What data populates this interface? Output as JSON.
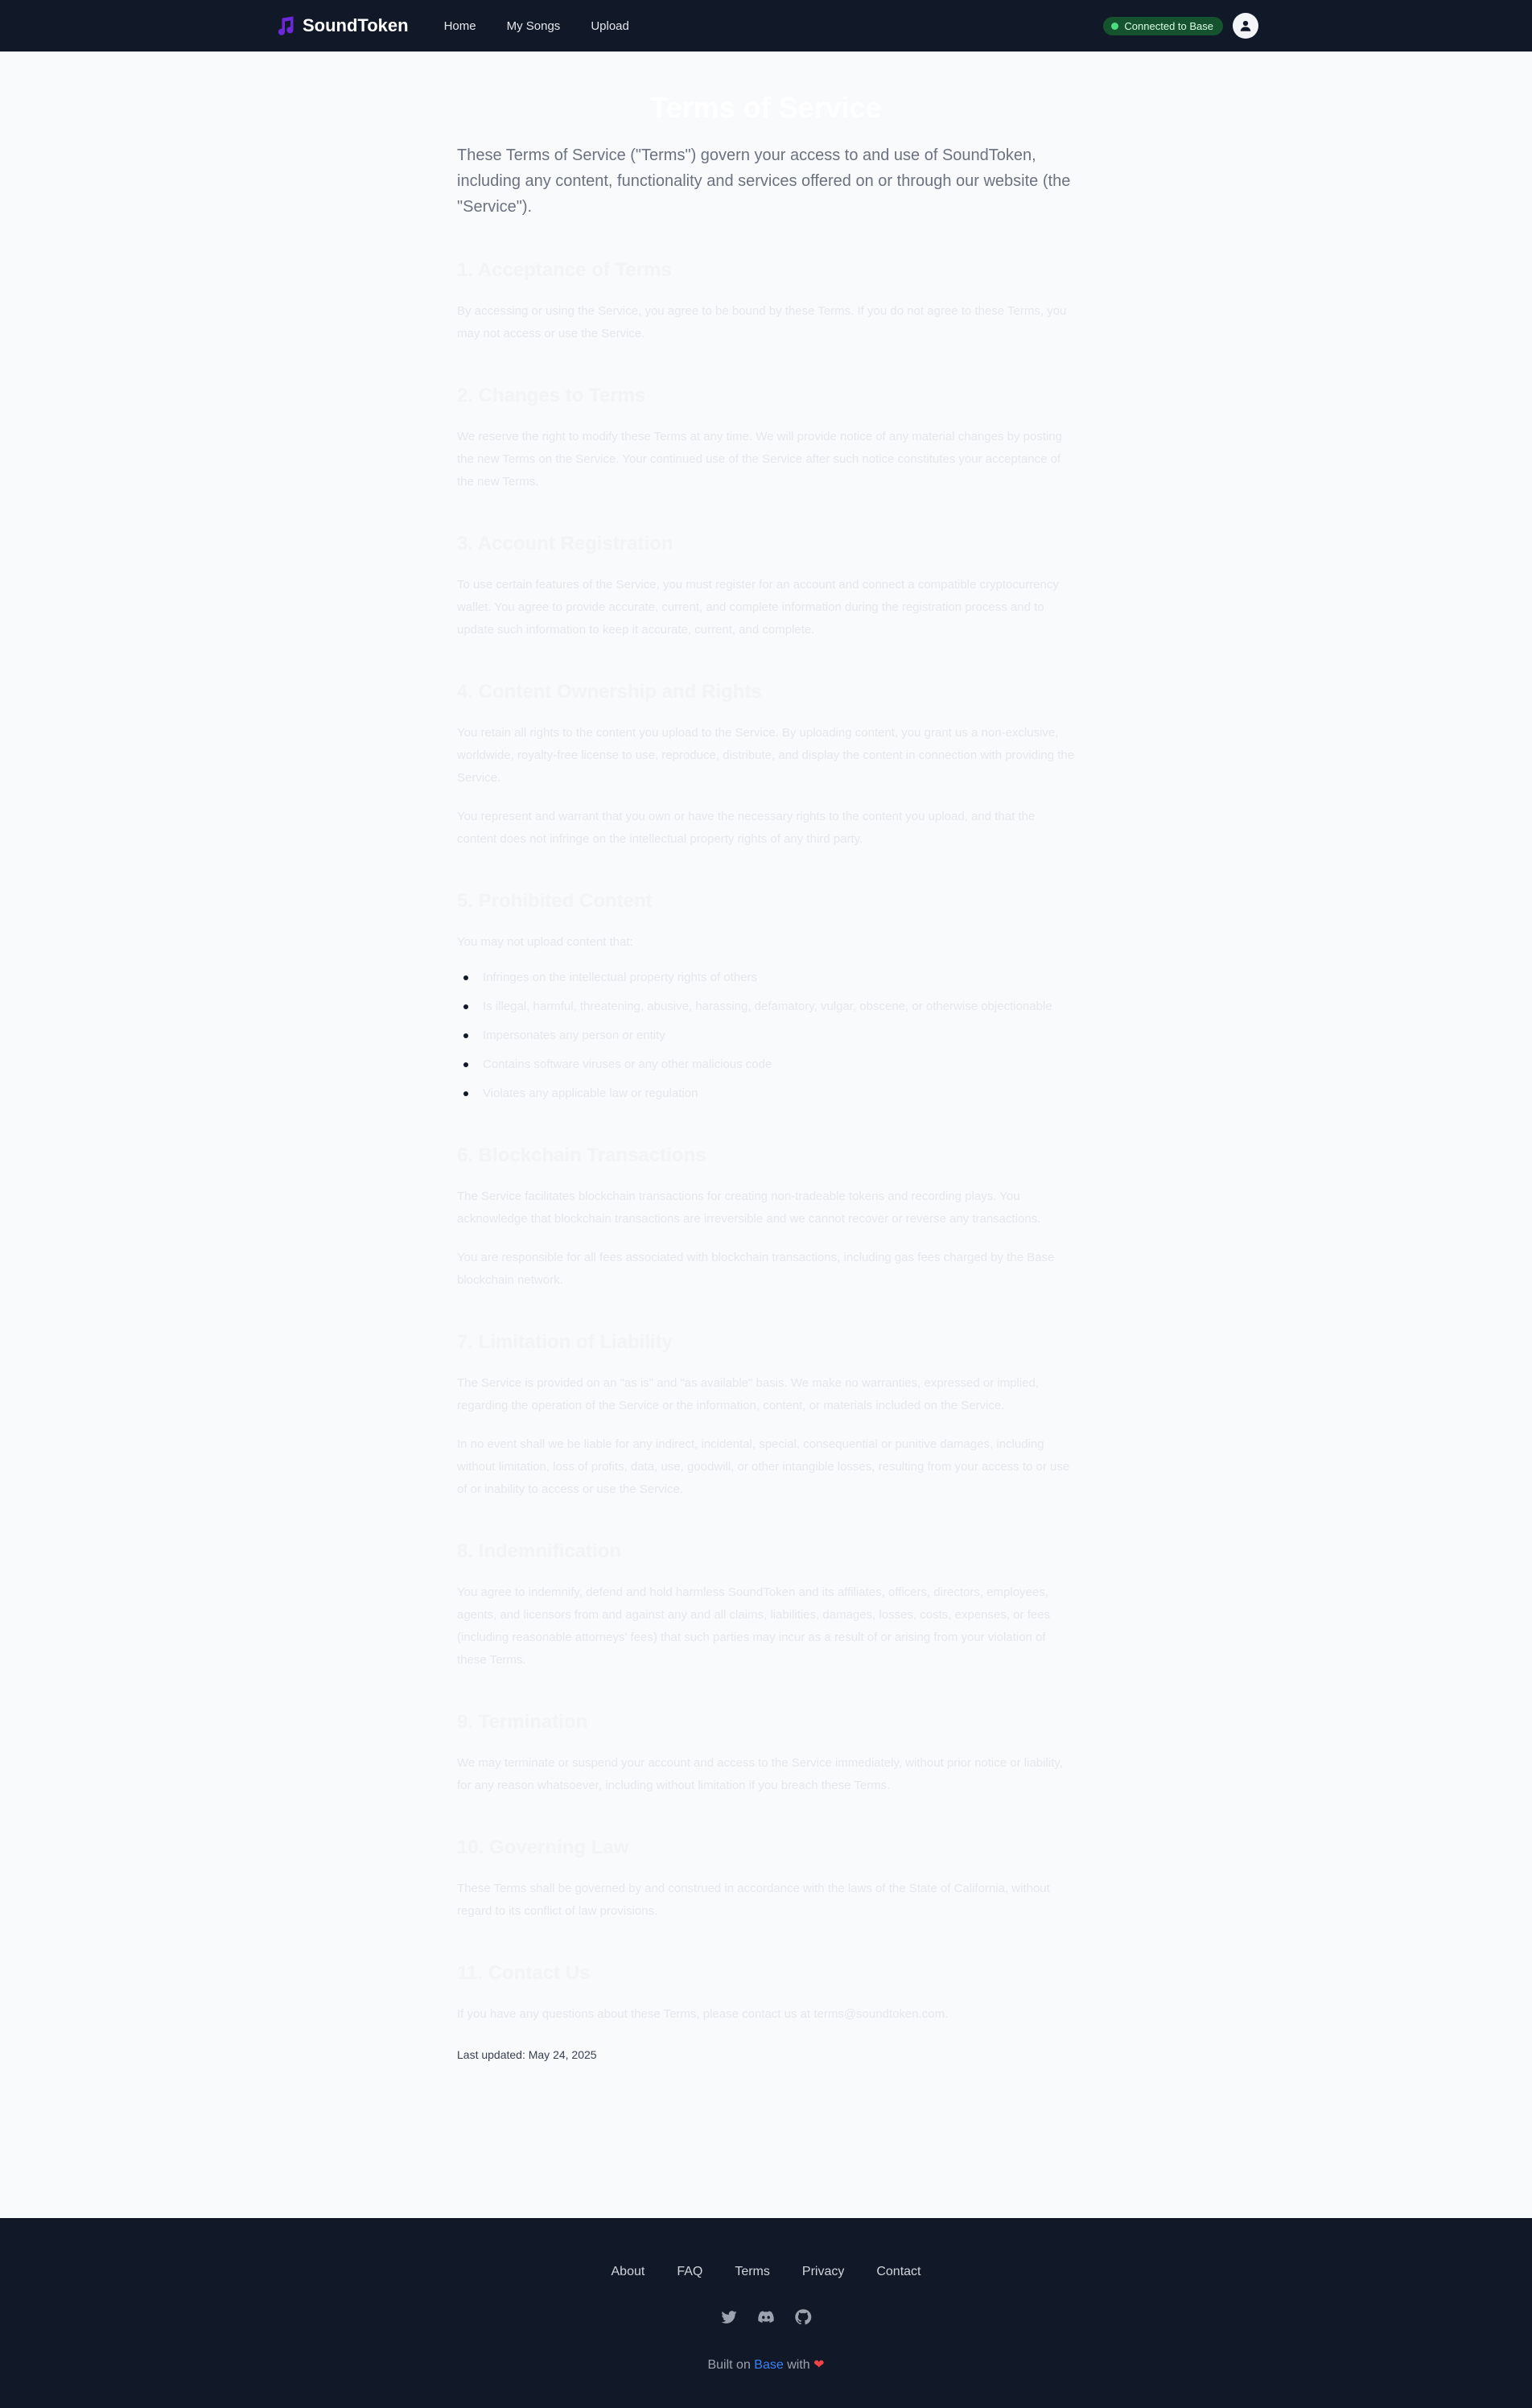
{
  "nav": {
    "brand": "SoundToken",
    "links": [
      "Home",
      "My Songs",
      "Upload"
    ],
    "status": "Connected to Base"
  },
  "page": {
    "title": "Terms of Service",
    "intro": "These Terms of Service (\"Terms\") govern your access to and use of SoundToken, including any content, functionality and services offered on or through our website (the \"Service\").",
    "sections": [
      {
        "heading": "1. Acceptance of Terms",
        "paragraphs": [
          "By accessing or using the Service, you agree to be bound by these Terms. If you do not agree to these Terms, you may not access or use the Service."
        ]
      },
      {
        "heading": "2. Changes to Terms",
        "paragraphs": [
          "We reserve the right to modify these Terms at any time. We will provide notice of any material changes by posting the new Terms on the Service. Your continued use of the Service after such notice constitutes your acceptance of the new Terms."
        ]
      },
      {
        "heading": "3. Account Registration",
        "paragraphs": [
          "To use certain features of the Service, you must register for an account and connect a compatible cryptocurrency wallet. You agree to provide accurate, current, and complete information during the registration process and to update such information to keep it accurate, current, and complete."
        ]
      },
      {
        "heading": "4. Content Ownership and Rights",
        "paragraphs": [
          "You retain all rights to the content you upload to the Service. By uploading content, you grant us a non-exclusive, worldwide, royalty-free license to use, reproduce, distribute, and display the content in connection with providing the Service.",
          "You represent and warrant that you own or have the necessary rights to the content you upload, and that the content does not infringe on the intellectual property rights of any third party."
        ]
      },
      {
        "heading": "5. Prohibited Content",
        "paragraphs": [
          "You may not upload content that:"
        ],
        "items": [
          "Infringes on the intellectual property rights of others",
          "Is illegal, harmful, threatening, abusive, harassing, defamatory, vulgar, obscene, or otherwise objectionable",
          "Impersonates any person or entity",
          "Contains software viruses or any other malicious code",
          "Violates any applicable law or regulation"
        ]
      },
      {
        "heading": "6. Blockchain Transactions",
        "paragraphs": [
          "The Service facilitates blockchain transactions for creating non-tradeable tokens and recording plays. You acknowledge that blockchain transactions are irreversible and we cannot recover or reverse any transactions.",
          "You are responsible for all fees associated with blockchain transactions, including gas fees charged by the Base blockchain network."
        ]
      },
      {
        "heading": "7. Limitation of Liability",
        "paragraphs": [
          "The Service is provided on an \"as is\" and \"as available\" basis. We make no warranties, expressed or implied, regarding the operation of the Service or the information, content, or materials included on the Service.",
          "In no event shall we be liable for any indirect, incidental, special, consequential or punitive damages, including without limitation, loss of profits, data, use, goodwill, or other intangible losses, resulting from your access to or use of or inability to access or use the Service."
        ]
      },
      {
        "heading": "8. Indemnification",
        "paragraphs": [
          "You agree to indemnify, defend and hold harmless SoundToken and its affiliates, officers, directors, employees, agents, and licensors from and against any and all claims, liabilities, damages, losses, costs, expenses, or fees (including reasonable attorneys' fees) that such parties may incur as a result of or arising from your violation of these Terms."
        ]
      },
      {
        "heading": "9. Termination",
        "paragraphs": [
          "We may terminate or suspend your account and access to the Service immediately, without prior notice or liability, for any reason whatsoever, including without limitation if you breach these Terms."
        ]
      },
      {
        "heading": "10. Governing Law",
        "paragraphs": [
          "These Terms shall be governed by and construed in accordance with the laws of the State of California, without regard to its conflict of law provisions."
        ]
      },
      {
        "heading": "11. Contact Us",
        "paragraphs": [
          "If you have any questions about these Terms, please contact us at terms@soundtoken.com."
        ]
      }
    ],
    "last_updated": "Last updated: May 24, 2025"
  },
  "footer": {
    "links": [
      "About",
      "FAQ",
      "Terms",
      "Privacy",
      "Contact"
    ],
    "icons": [
      "twitter-icon",
      "discord-icon",
      "github-icon"
    ],
    "built_prefix": "Built on",
    "built_link": "Base",
    "built_suffix": "with",
    "heart": "❤"
  },
  "colors": {
    "nav_bg": "#111827",
    "brand_accent": "#6d28d9",
    "status_bg": "#14532d",
    "status_dot": "#4ade80",
    "link_blue": "#3b82f6",
    "heart_red": "#ef4444"
  }
}
